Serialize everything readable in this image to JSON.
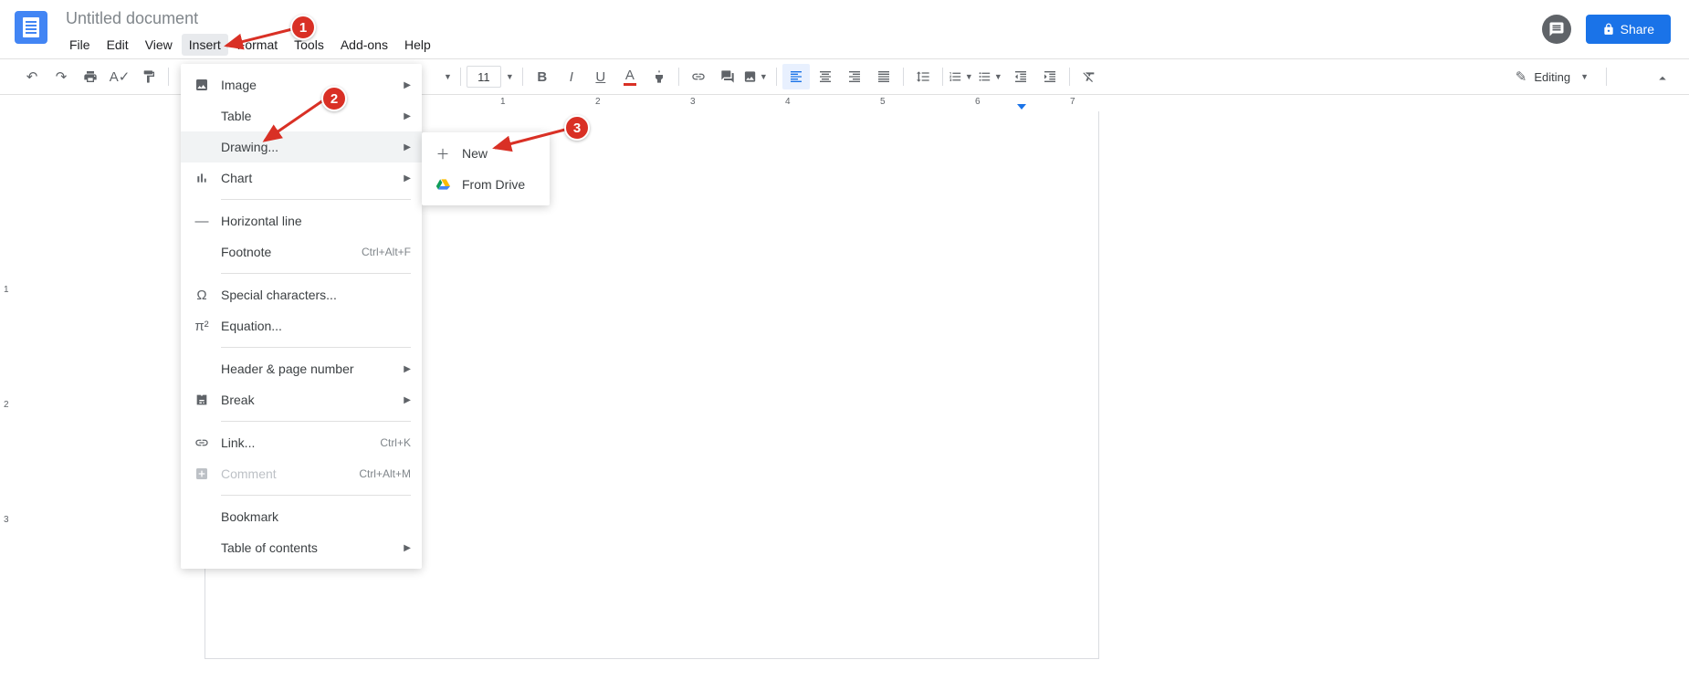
{
  "header": {
    "title": "Untitled document",
    "menus": [
      "File",
      "Edit",
      "View",
      "Insert",
      "Format",
      "Tools",
      "Add-ons",
      "Help"
    ],
    "active_menu_index": 3,
    "share_label": "Share"
  },
  "toolbar": {
    "font_size": "11",
    "editing_label": "Editing"
  },
  "insert_menu": {
    "items": [
      {
        "icon": "image",
        "label": "Image",
        "arrow": true
      },
      {
        "icon": "table",
        "label": "Table",
        "arrow": true
      },
      {
        "icon": "drawing",
        "label": "Drawing...",
        "arrow": true,
        "highlighted": true
      },
      {
        "icon": "chart",
        "label": "Chart",
        "arrow": true
      },
      {
        "divider": true
      },
      {
        "icon": "hr",
        "label": "Horizontal line"
      },
      {
        "icon": "footnote",
        "label": "Footnote",
        "shortcut": "Ctrl+Alt+F"
      },
      {
        "divider": true
      },
      {
        "icon": "omega",
        "label": "Special characters..."
      },
      {
        "icon": "pi",
        "label": "Equation..."
      },
      {
        "divider": true
      },
      {
        "icon": "header",
        "label": "Header & page number",
        "arrow": true
      },
      {
        "icon": "break",
        "label": "Break",
        "arrow": true
      },
      {
        "divider": true
      },
      {
        "icon": "link",
        "label": "Link...",
        "shortcut": "Ctrl+K"
      },
      {
        "icon": "comment",
        "label": "Comment",
        "shortcut": "Ctrl+Alt+M",
        "disabled": true
      },
      {
        "divider": true
      },
      {
        "icon": "bookmark",
        "label": "Bookmark"
      },
      {
        "icon": "toc",
        "label": "Table of contents",
        "arrow": true
      }
    ]
  },
  "drawing_submenu": {
    "items": [
      {
        "icon": "plus",
        "label": "New"
      },
      {
        "icon": "drive",
        "label": "From Drive"
      }
    ]
  },
  "ruler": {
    "h_numbers": [
      "1",
      "2",
      "3",
      "4",
      "5",
      "6",
      "7"
    ],
    "v_numbers": [
      "1",
      "2",
      "3"
    ]
  },
  "callouts": {
    "c1": "1",
    "c2": "2",
    "c3": "3"
  }
}
